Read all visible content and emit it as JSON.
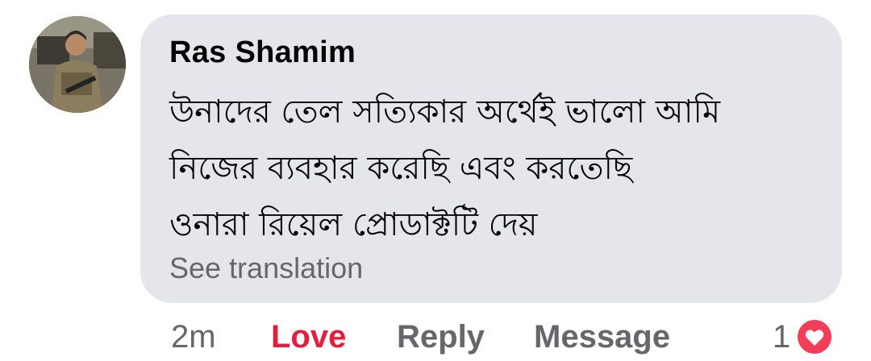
{
  "comment": {
    "author": "Ras Shamim",
    "text_lines": [
      "উনাদের তেল সত্যিকার অর্থেই ভালো আমি",
      "নিজের ব্যবহার করেছি এবং করতেছি",
      "ওনারা রিয়েল প্রোডাক্টটি দেয়"
    ],
    "see_translation": "See translation"
  },
  "actions": {
    "time": "2m",
    "love": "Love",
    "reply": "Reply",
    "message": "Message"
  },
  "reactions": {
    "count": "1",
    "icon": "heart-icon",
    "color": "#f33e58"
  },
  "colors": {
    "bubble": "#e4e6eb",
    "love_active": "#e41e3f",
    "secondary_text": "#65676b"
  }
}
